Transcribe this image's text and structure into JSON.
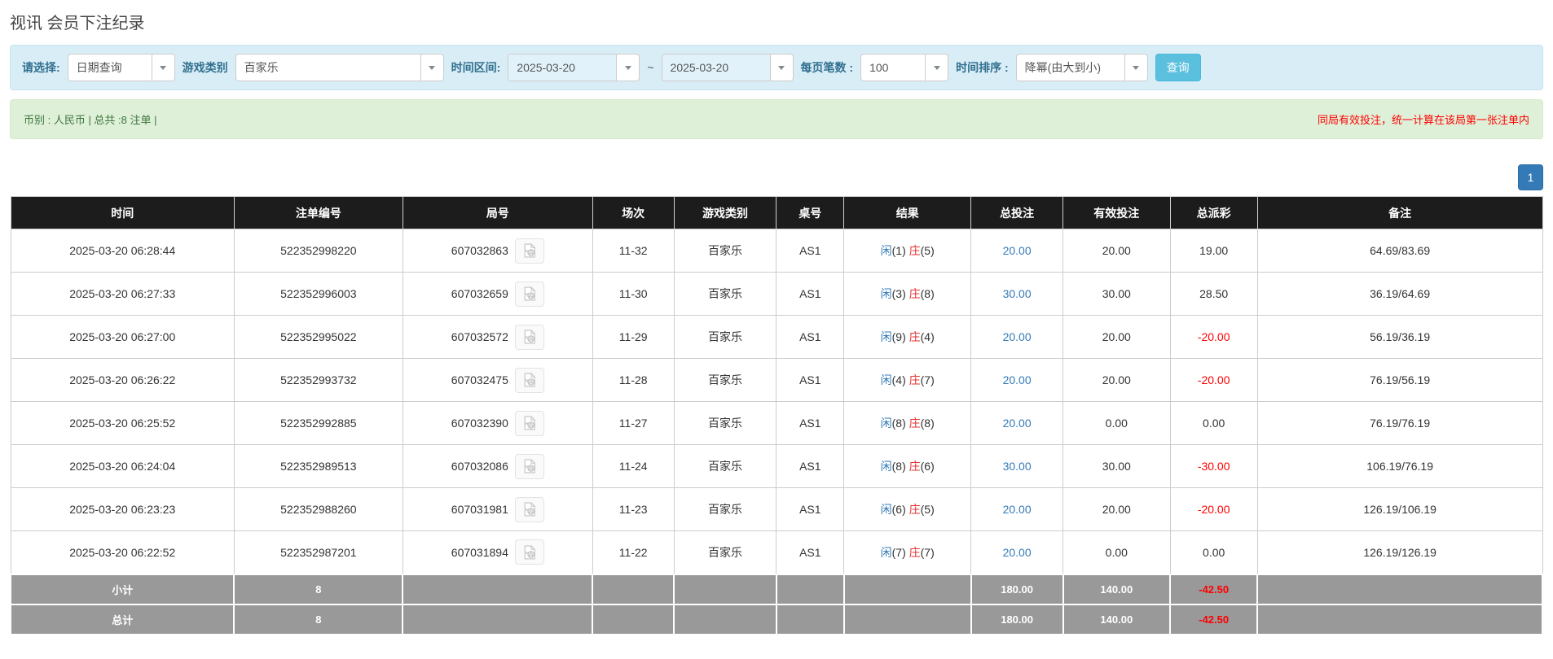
{
  "page_title": "视讯 会员下注纪录",
  "filter": {
    "select_label": "请选择:",
    "select_value": "日期查询",
    "game_label": "游戏类别",
    "game_value": "百家乐",
    "range_label": "时间区间:",
    "date_from": "2025-03-20",
    "tilde": "~",
    "date_to": "2025-03-20",
    "per_page_label": "每页笔数 :",
    "per_page_value": "100",
    "sort_label": "时间排序 :",
    "sort_value": "降幂(由大到小)",
    "query_button": "查询"
  },
  "summary_bar": {
    "left_text": "币别 : 人民币 | 总共 :8 注单 |",
    "right_notice": "同局有效投注，统一计算在该局第一张注单内"
  },
  "pagination": {
    "page": "1"
  },
  "table": {
    "headers": [
      "时间",
      "注单编号",
      "局号",
      "场次",
      "游戏类别",
      "桌号",
      "结果",
      "总投注",
      "有效投注",
      "总派彩",
      "备注"
    ],
    "rows": [
      {
        "time": "2025-03-20 06:28:44",
        "bet_no": "522352998220",
        "round_no": "607032863",
        "session": "11-32",
        "game": "百家乐",
        "table_no": "AS1",
        "result": {
          "player": "闲",
          "player_n": "(1)",
          "banker": "庄",
          "banker_n": "(5)"
        },
        "total_bet": "20.00",
        "valid_bet": "20.00",
        "payout": "19.00",
        "remark": "64.69/83.69"
      },
      {
        "time": "2025-03-20 06:27:33",
        "bet_no": "522352996003",
        "round_no": "607032659",
        "session": "11-30",
        "game": "百家乐",
        "table_no": "AS1",
        "result": {
          "player": "闲",
          "player_n": "(3)",
          "banker": "庄",
          "banker_n": "(8)"
        },
        "total_bet": "30.00",
        "valid_bet": "30.00",
        "payout": "28.50",
        "remark": "36.19/64.69"
      },
      {
        "time": "2025-03-20 06:27:00",
        "bet_no": "522352995022",
        "round_no": "607032572",
        "session": "11-29",
        "game": "百家乐",
        "table_no": "AS1",
        "result": {
          "player": "闲",
          "player_n": "(9)",
          "banker": "庄",
          "banker_n": "(4)"
        },
        "total_bet": "20.00",
        "valid_bet": "20.00",
        "payout": "-20.00",
        "remark": "56.19/36.19"
      },
      {
        "time": "2025-03-20 06:26:22",
        "bet_no": "522352993732",
        "round_no": "607032475",
        "session": "11-28",
        "game": "百家乐",
        "table_no": "AS1",
        "result": {
          "player": "闲",
          "player_n": "(4)",
          "banker": "庄",
          "banker_n": "(7)"
        },
        "total_bet": "20.00",
        "valid_bet": "20.00",
        "payout": "-20.00",
        "remark": "76.19/56.19"
      },
      {
        "time": "2025-03-20 06:25:52",
        "bet_no": "522352992885",
        "round_no": "607032390",
        "session": "11-27",
        "game": "百家乐",
        "table_no": "AS1",
        "result": {
          "player": "闲",
          "player_n": "(8)",
          "banker": "庄",
          "banker_n": "(8)"
        },
        "total_bet": "20.00",
        "valid_bet": "0.00",
        "payout": "0.00",
        "remark": "76.19/76.19"
      },
      {
        "time": "2025-03-20 06:24:04",
        "bet_no": "522352989513",
        "round_no": "607032086",
        "session": "11-24",
        "game": "百家乐",
        "table_no": "AS1",
        "result": {
          "player": "闲",
          "player_n": "(8)",
          "banker": "庄",
          "banker_n": "(6)"
        },
        "total_bet": "30.00",
        "valid_bet": "30.00",
        "payout": "-30.00",
        "remark": "106.19/76.19"
      },
      {
        "time": "2025-03-20 06:23:23",
        "bet_no": "522352988260",
        "round_no": "607031981",
        "session": "11-23",
        "game": "百家乐",
        "table_no": "AS1",
        "result": {
          "player": "闲",
          "player_n": "(6)",
          "banker": "庄",
          "banker_n": "(5)"
        },
        "total_bet": "20.00",
        "valid_bet": "20.00",
        "payout": "-20.00",
        "remark": "126.19/106.19"
      },
      {
        "time": "2025-03-20 06:22:52",
        "bet_no": "522352987201",
        "round_no": "607031894",
        "session": "11-22",
        "game": "百家乐",
        "table_no": "AS1",
        "result": {
          "player": "闲",
          "player_n": "(7)",
          "banker": "庄",
          "banker_n": "(7)"
        },
        "total_bet": "20.00",
        "valid_bet": "0.00",
        "payout": "0.00",
        "remark": "126.19/126.19"
      }
    ],
    "subtotal_row": {
      "label": "小计",
      "count": "8",
      "total_bet": "180.00",
      "valid_bet": "140.00",
      "payout": "-42.50"
    },
    "total_row": {
      "label": "总计",
      "count": "8",
      "total_bet": "180.00",
      "valid_bet": "140.00",
      "payout": "-42.50"
    }
  },
  "colors": {
    "accent_blue": "#337ab7",
    "result_player_blue": "#337ab7",
    "result_banker_red": "#e33434",
    "negative_red": "#fe0000",
    "query_button_bg": "#5bc0de",
    "filter_panel_bg": "#d9edf7",
    "summary_bar_bg": "#dff0d8",
    "table_header_bg": "#1c1c1c",
    "table_footer_bg": "#999999"
  }
}
